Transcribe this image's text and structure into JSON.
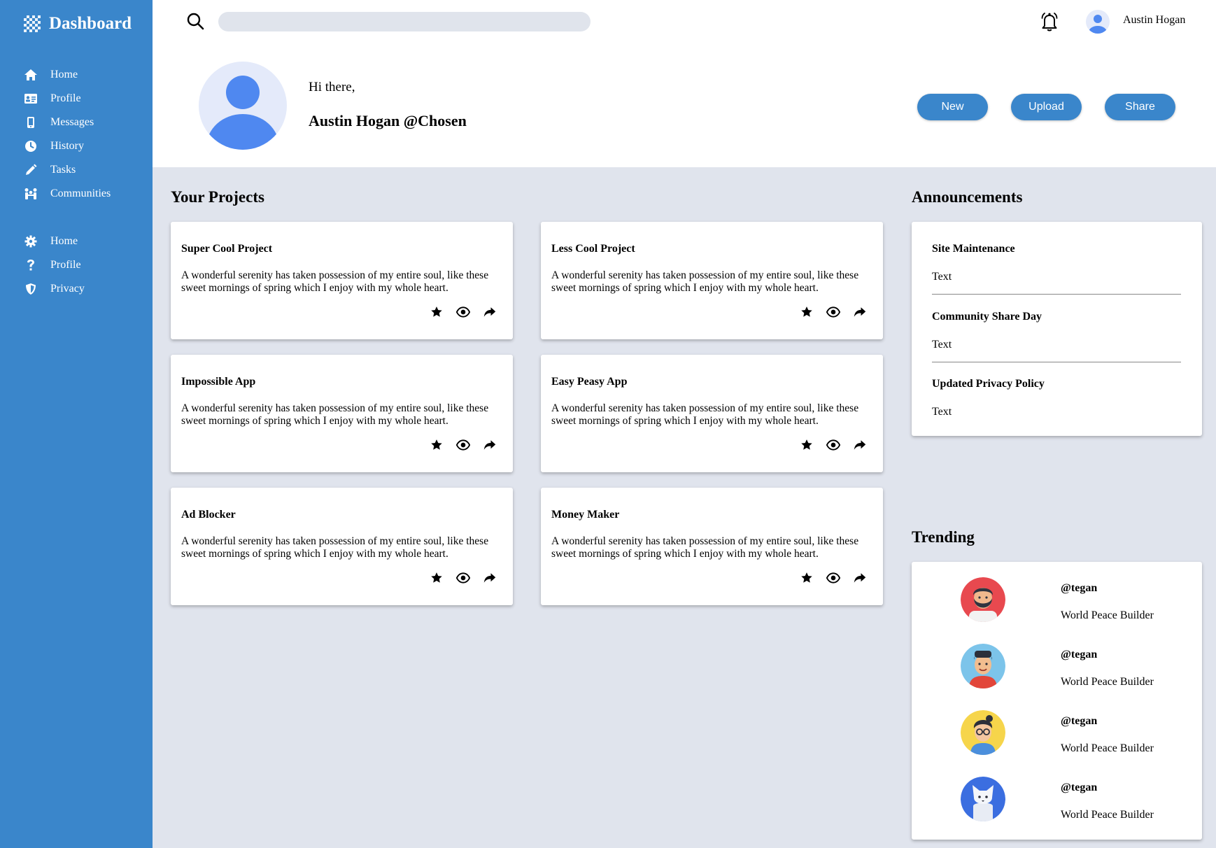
{
  "brand": {
    "name": "Dashboard"
  },
  "sidebar": {
    "primary": [
      {
        "label": "Home",
        "icon": "home-icon"
      },
      {
        "label": "Profile",
        "icon": "id-card-icon"
      },
      {
        "label": "Messages",
        "icon": "phone-icon"
      },
      {
        "label": "History",
        "icon": "clock-icon"
      },
      {
        "label": "Tasks",
        "icon": "pencil-icon"
      },
      {
        "label": "Communities",
        "icon": "people-icon"
      }
    ],
    "secondary": [
      {
        "label": "Home",
        "icon": "gear-icon"
      },
      {
        "label": "Profile",
        "icon": "question-icon"
      },
      {
        "label": "Privacy",
        "icon": "shield-icon"
      }
    ]
  },
  "topbar": {
    "search_placeholder": "",
    "user_name": "Austin Hogan"
  },
  "header": {
    "greeting": "Hi there,",
    "handle": "Austin Hogan @Chosen",
    "buttons": {
      "new": "New",
      "upload": "Upload",
      "share": "Share"
    }
  },
  "projects": {
    "title": "Your Projects",
    "items": [
      {
        "title": "Super Cool Project",
        "description": "A wonderful serenity has taken possession of my entire soul, like these sweet mornings of spring which I enjoy with my whole heart."
      },
      {
        "title": "Less Cool Project",
        "description": "A wonderful serenity has taken possession of my entire soul, like these sweet mornings of spring which I enjoy with my whole heart."
      },
      {
        "title": "Impossible App",
        "description": "A wonderful serenity has taken possession of my entire soul, like these sweet mornings of spring which I enjoy with my whole heart."
      },
      {
        "title": "Easy Peasy App",
        "description": "A wonderful serenity has taken possession of my entire soul, like these sweet mornings of spring which I enjoy with my whole heart."
      },
      {
        "title": "Ad Blocker",
        "description": "A wonderful serenity has taken possession of my entire soul, like these sweet mornings of spring which I enjoy with my whole heart."
      },
      {
        "title": "Money Maker",
        "description": "A wonderful serenity has taken possession of my entire soul, like these sweet mornings of spring which I enjoy with my whole heart."
      }
    ]
  },
  "announcements": {
    "title": "Announcements",
    "items": [
      {
        "title": "Site Maintenance",
        "body": "Text"
      },
      {
        "title": "Community Share Day",
        "body": "Text"
      },
      {
        "title": "Updated Privacy Policy",
        "body": "Text"
      }
    ]
  },
  "trending": {
    "title": "Trending",
    "items": [
      {
        "user": "@tegan",
        "role": "World Peace Builder",
        "avatar_bg": "#e8494f"
      },
      {
        "user": "@tegan",
        "role": "World Peace Builder",
        "avatar_bg": "#7cc4ea"
      },
      {
        "user": "@tegan",
        "role": "World Peace Builder",
        "avatar_bg": "#f6d54b"
      },
      {
        "user": "@tegan",
        "role": "World Peace Builder",
        "avatar_bg": "#3b6ee0"
      }
    ]
  },
  "colors": {
    "sidebar": "#3a86cb",
    "button": "#3a86cb",
    "page_background": "#e0e4ed",
    "avatar_accent": "#4f88f0"
  }
}
